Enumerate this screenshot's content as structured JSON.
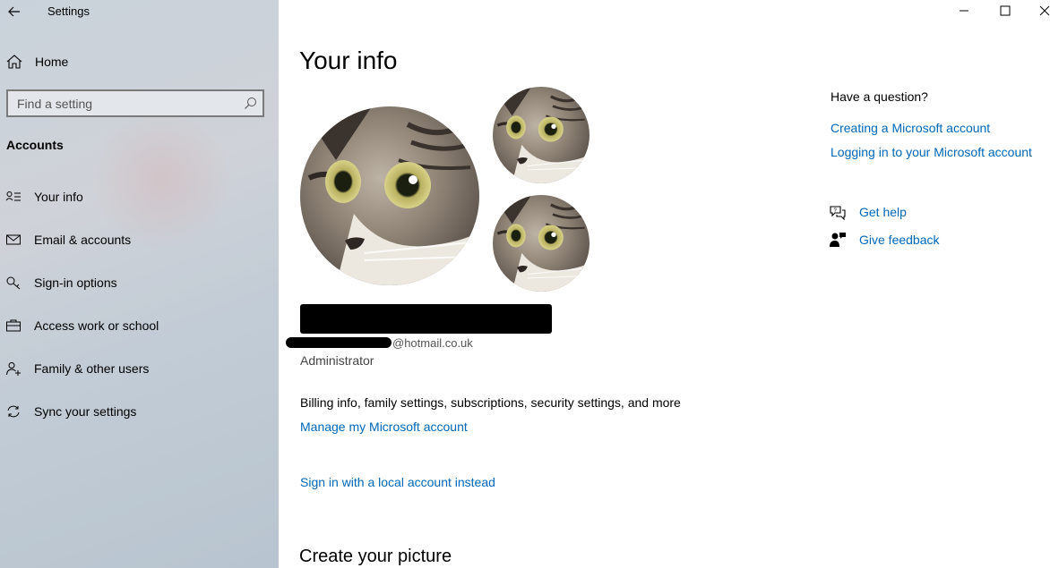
{
  "window": {
    "title": "Settings"
  },
  "sidebar": {
    "home_label": "Home",
    "search_placeholder": "Find a setting",
    "section_title": "Accounts",
    "items": [
      {
        "label": "Your info",
        "icon": "contact-card-icon"
      },
      {
        "label": "Email & accounts",
        "icon": "mail-icon"
      },
      {
        "label": "Sign-in options",
        "icon": "key-icon"
      },
      {
        "label": "Access work or school",
        "icon": "briefcase-icon"
      },
      {
        "label": "Family & other users",
        "icon": "add-person-icon"
      },
      {
        "label": "Sync your settings",
        "icon": "sync-icon"
      }
    ]
  },
  "main": {
    "title": "Your info",
    "email_suffix": "@hotmail.co.uk",
    "role": "Administrator",
    "billing_text": "Billing info, family settings, subscriptions, security settings, and more",
    "manage_link": "Manage my Microsoft account",
    "local_account_link": "Sign in with a local account instead",
    "create_picture_title": "Create your picture"
  },
  "help": {
    "question": "Have a question?",
    "link_create": "Creating a Microsoft account",
    "link_login": "Logging in to your Microsoft account",
    "get_help": "Get help",
    "give_feedback": "Give feedback"
  },
  "colors": {
    "link": "#0067b8",
    "sidebar_bg": "#c9d2db"
  }
}
